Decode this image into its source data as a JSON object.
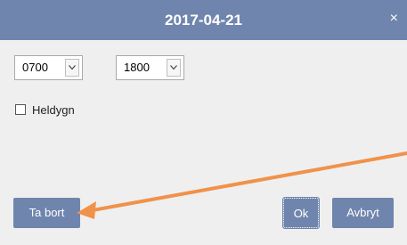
{
  "dialog": {
    "title": "2017-04-21",
    "close_symbol": "×",
    "from_time": "0700",
    "to_time": "1800",
    "allday_label": "Heldygn",
    "allday_checked": false,
    "buttons": {
      "delete_label": "Ta bort",
      "ok_label": "Ok",
      "cancel_label": "Avbryt"
    }
  },
  "colors": {
    "titlebar": "#6f85ad",
    "button": "#6f85ad",
    "body": "#efefef",
    "annotation_arrow": "#f0924a"
  },
  "annotation": {
    "icon": "arrow-annotation"
  }
}
